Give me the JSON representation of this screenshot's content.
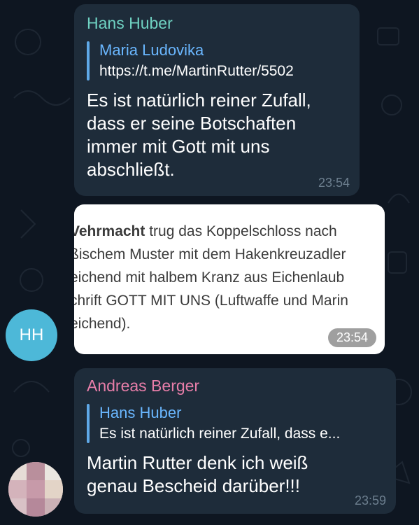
{
  "colors": {
    "background": "#0e1621",
    "bubble": "#1e2c3a",
    "sender_hans": "#6fd2c2",
    "sender_andreas": "#e87ea9",
    "reply_accent": "#5fa9e8",
    "avatar_hh": "#4db8d8"
  },
  "messages": [
    {
      "sender": "Hans Huber",
      "reply": {
        "name": "Maria Ludovika",
        "text": "https://t.me/MartinRutter/5502"
      },
      "text_lines": [
        "Es ist natürlich reiner Zufall,",
        "dass er seine Botschaften",
        "immer mit Gott mit uns",
        "abschließt."
      ],
      "time": "23:54"
    },
    {
      "image_lines": [
        "Wehrmacht trug das Koppelschloss nach",
        "ßischem Muster mit dem Hakenkreuzadler",
        "eichend mit halbem Kranz aus Eichenlaub",
        "chrift GOTT MIT UNS (Luftwaffe und Marin",
        "eichend)."
      ],
      "image_bold_word": "Vehrmacht",
      "time": "23:54"
    },
    {
      "sender": "Andreas Berger",
      "reply": {
        "name": "Hans Huber",
        "text": "Es ist natürlich reiner Zufall, dass e..."
      },
      "text_lines": [
        "Martin Rutter denk ich weiß",
        "genau Bescheid darüber!!!"
      ],
      "time": "23:59"
    }
  ],
  "avatars": {
    "hh_initials": "HH"
  }
}
